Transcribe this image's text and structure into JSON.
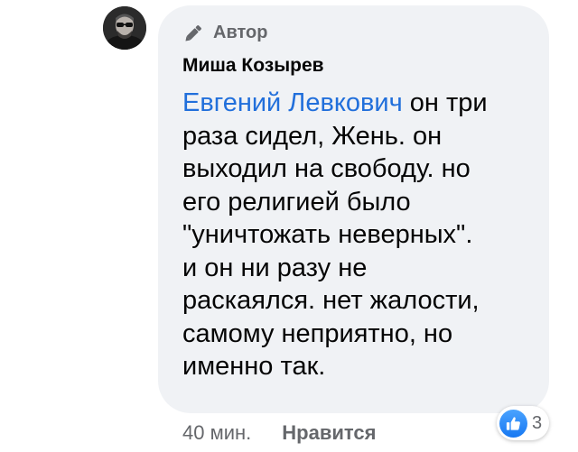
{
  "comment": {
    "author_badge": "Автор",
    "author_name": "Миша Козырев",
    "mention": "Евгений Левкович",
    "text_lines": [
      " он три",
      "раза сидел, Жень. он",
      "выходил на свободу. но",
      "его религией было",
      "\"уничтожать неверных\".",
      "и он ни разу не",
      "раскаялся. нет жалости,",
      "самому неприятно, но",
      "именно так."
    ]
  },
  "actions": {
    "time": "40 мин.",
    "like": "Нравится"
  },
  "reactions": {
    "count": "3",
    "icon": "thumbs-up-icon"
  },
  "colors": {
    "bubble": "#f0f2f5",
    "mention": "#216fdb",
    "secondary_text": "#65676b",
    "like_blue": "#1778f2"
  }
}
